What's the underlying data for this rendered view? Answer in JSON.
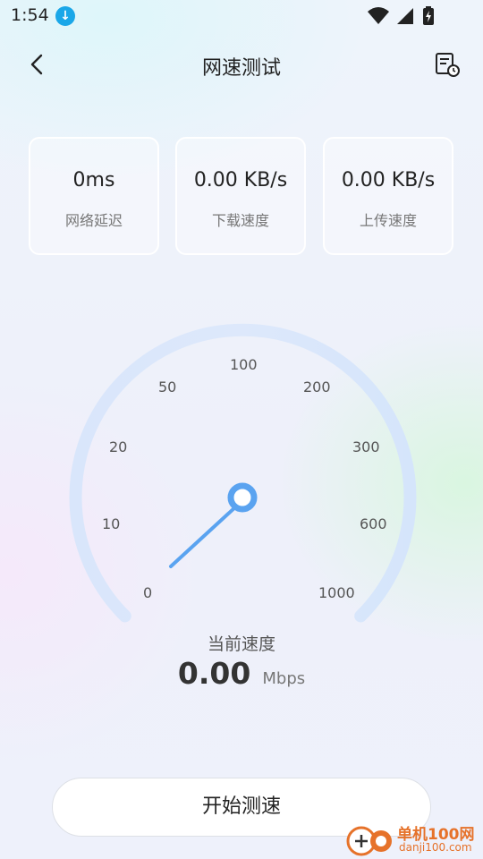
{
  "status_bar": {
    "time": "1:54",
    "icons": [
      "download-icon",
      "wifi-icon",
      "signal-icon",
      "battery-icon"
    ]
  },
  "header": {
    "title": "网速测试",
    "back_icon": "chevron-left-icon",
    "history_icon": "history-icon"
  },
  "stats": [
    {
      "value": "0ms",
      "label": "网络延迟"
    },
    {
      "value": "0.00 KB/s",
      "label": "下载速度"
    },
    {
      "value": "0.00 KB/s",
      "label": "上传速度"
    }
  ],
  "gauge": {
    "ticks": [
      "0",
      "10",
      "20",
      "50",
      "100",
      "200",
      "300",
      "600",
      "1000"
    ],
    "needle_value": 0,
    "colors": {
      "arc": "#d7e6fb",
      "needle": "#5aa3f0"
    }
  },
  "current": {
    "label": "当前速度",
    "value": "0.00",
    "unit": "Mbps"
  },
  "start_button": {
    "label": "开始测速"
  },
  "watermark": {
    "line1": "单机100网",
    "line2": "danji100.com"
  }
}
